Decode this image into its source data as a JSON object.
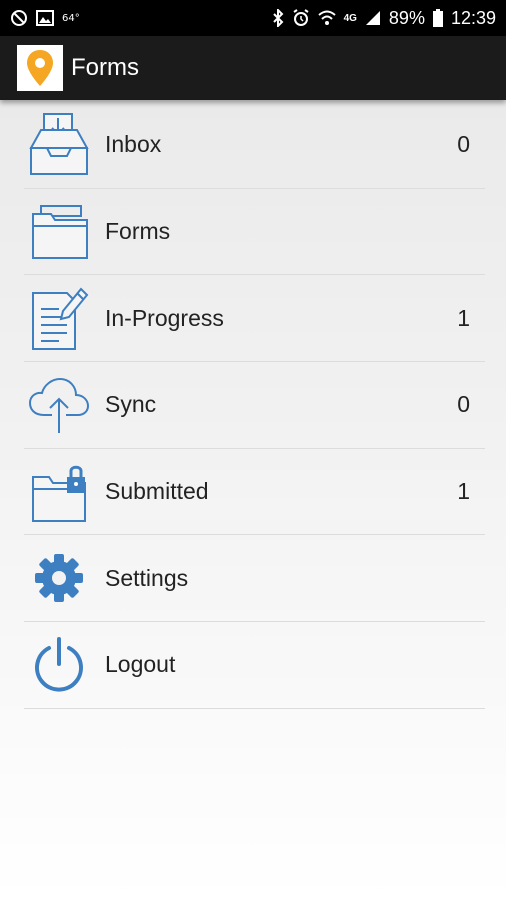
{
  "status_bar": {
    "temperature": "64°",
    "network": "4G",
    "battery_percent": "89%",
    "time": "12:39",
    "icons": [
      "do-not-disturb-icon",
      "image-icon",
      "bluetooth-icon",
      "alarm-icon",
      "wifi-icon",
      "signal-icon",
      "battery-icon"
    ]
  },
  "app_bar": {
    "title": "Forms",
    "logo_icon": "map-pin-logo-icon",
    "accent_color": "#f5a623"
  },
  "menu": {
    "icon_color": "#3d7fc1",
    "items": [
      {
        "label": "Inbox",
        "count": "0",
        "icon": "inbox-icon"
      },
      {
        "label": "Forms",
        "count": "",
        "icon": "folder-icon"
      },
      {
        "label": "In-Progress",
        "count": "1",
        "icon": "document-edit-icon"
      },
      {
        "label": "Sync",
        "count": "0",
        "icon": "cloud-upload-icon"
      },
      {
        "label": "Submitted",
        "count": "1",
        "icon": "locked-folder-icon"
      },
      {
        "label": "Settings",
        "count": "",
        "icon": "gear-icon"
      },
      {
        "label": "Logout",
        "count": "",
        "icon": "power-icon"
      }
    ]
  }
}
